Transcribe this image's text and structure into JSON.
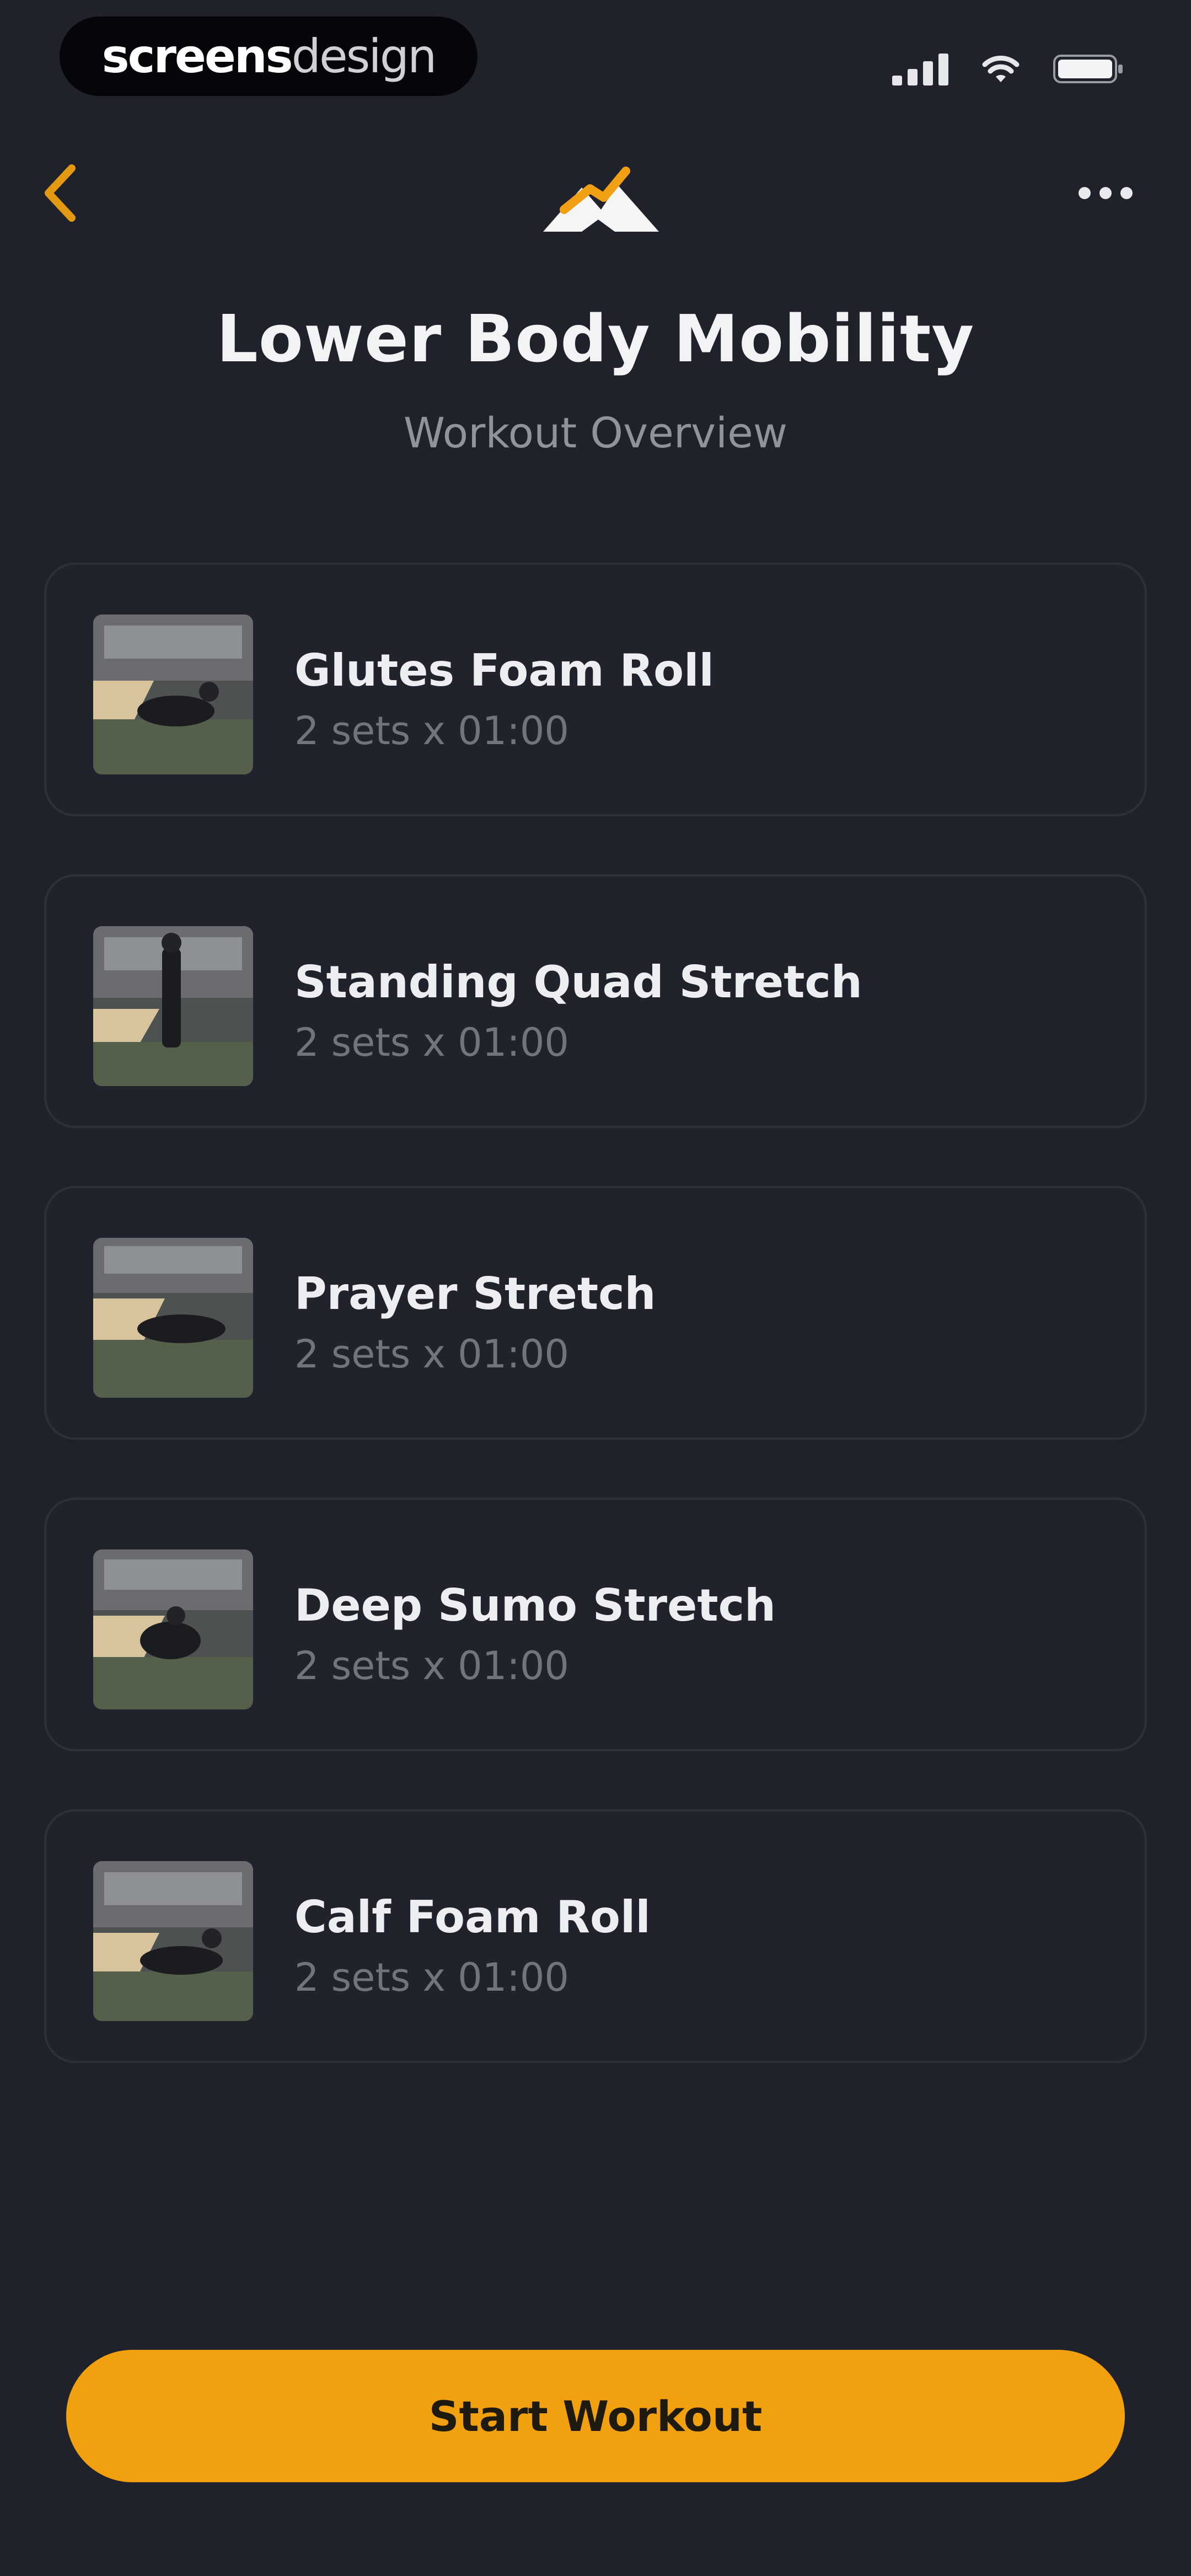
{
  "status_bar": {
    "brand_bold": "screens",
    "brand_light": "design",
    "icons": [
      "signal-icon",
      "wifi-icon",
      "battery-icon"
    ]
  },
  "nav": {
    "back_icon": "chevron-left-icon",
    "logo_icon": "mountain-logo-icon",
    "more_icon": "more-dots-icon"
  },
  "header": {
    "title": "Lower Body Mobility",
    "subtitle": "Workout Overview"
  },
  "exercises": [
    {
      "name": "Glutes Foam Roll",
      "meta": "2 sets x 01:00"
    },
    {
      "name": "Standing Quad Stretch",
      "meta": "2 sets x 01:00"
    },
    {
      "name": "Prayer Stretch",
      "meta": "2 sets x 01:00"
    },
    {
      "name": "Deep Sumo Stretch",
      "meta": "2 sets x 01:00"
    },
    {
      "name": "Calf Foam Roll",
      "meta": "2 sets x 01:00"
    }
  ],
  "actions": {
    "start_label": "Start Workout"
  },
  "colors": {
    "background": "#1f212b",
    "accent": "#f1a10f",
    "card_border": "#2d303b",
    "text_secondary": "#8f939c"
  }
}
